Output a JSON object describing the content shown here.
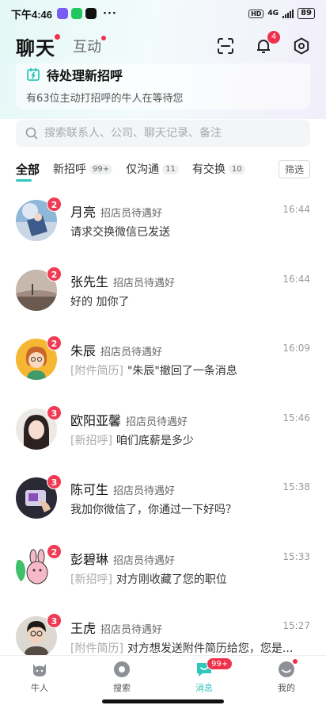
{
  "status_bar": {
    "time": "下午4:46",
    "more": "···",
    "hd": "HD",
    "network": "4G",
    "battery": "89"
  },
  "header": {
    "title": "聊天",
    "tab_interact": "互动",
    "notification_badge": "4"
  },
  "pending": {
    "title": "待处理新招呼",
    "subtitle": "有63位主动打招呼的牛人在等待您"
  },
  "search": {
    "placeholder": "搜索联系人、公司、聊天记录、备注"
  },
  "filters": [
    {
      "label": "全部",
      "count": ""
    },
    {
      "label": "新招呼",
      "count": "99+"
    },
    {
      "label": "仅沟通",
      "count": "11"
    },
    {
      "label": "有交换",
      "count": "10"
    }
  ],
  "filter_button": "筛选",
  "conversations": [
    {
      "name": "月亮",
      "tag": "招店员待遇好",
      "time": "16:44",
      "badge": "2",
      "prefix": "",
      "message": "请求交换微信已发送"
    },
    {
      "name": "张先生",
      "tag": "招店员待遇好",
      "time": "16:44",
      "badge": "2",
      "prefix": "",
      "message": "好的 加你了"
    },
    {
      "name": "朱辰",
      "tag": "招店员待遇好",
      "time": "16:09",
      "badge": "2",
      "prefix": "[附件简历]",
      "message": "\"朱辰\"撤回了一条消息"
    },
    {
      "name": "欧阳亚馨",
      "tag": "招店员待遇好",
      "time": "15:46",
      "badge": "3",
      "prefix": "[新招呼]",
      "message": "咱们底薪是多少"
    },
    {
      "name": "陈可生",
      "tag": "招店员待遇好",
      "time": "15:38",
      "badge": "3",
      "prefix": "",
      "message": "我加你微信了，你通过一下好吗？"
    },
    {
      "name": "彭碧琳",
      "tag": "招店员待遇好",
      "time": "15:33",
      "badge": "2",
      "prefix": "[新招呼]",
      "message": "对方刚收藏了您的职位"
    },
    {
      "name": "王虎",
      "tag": "招店员待遇好",
      "time": "15:27",
      "badge": "3",
      "prefix": "[附件简历]",
      "message": "对方想发送附件简历给您，您是..."
    }
  ],
  "bottom_nav": [
    {
      "label": "牛人",
      "badge": ""
    },
    {
      "label": "搜索",
      "badge": ""
    },
    {
      "label": "消息",
      "badge": "99+"
    },
    {
      "label": "我的",
      "badge": ""
    }
  ],
  "colors": {
    "accent": "#2fc6bb",
    "badge_red": "#ef3b53"
  }
}
